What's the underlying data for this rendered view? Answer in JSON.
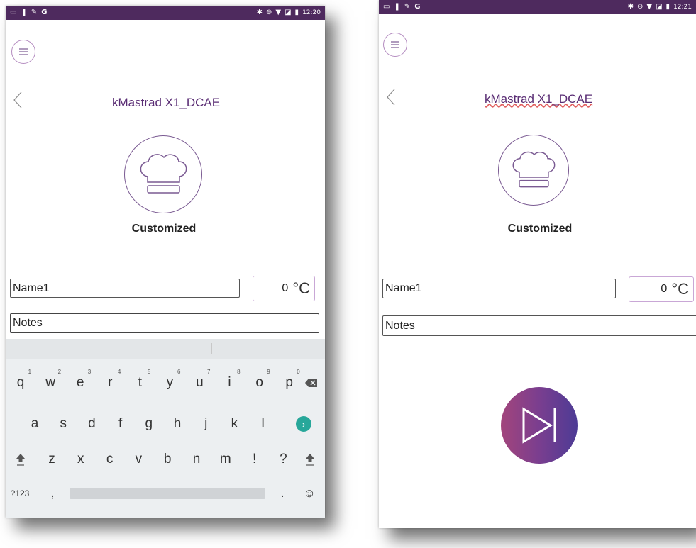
{
  "left_screen": {
    "status": {
      "time": "12:20"
    },
    "device_title": "kMastrad X1_DCAE",
    "mode_label": "Customized",
    "name_value": "Name1",
    "notes_value": "Notes",
    "temperature": {
      "value": "0",
      "unit": "°C"
    },
    "keyboard": {
      "row1": [
        {
          "k": "q",
          "h": "1"
        },
        {
          "k": "w",
          "h": "2"
        },
        {
          "k": "e",
          "h": "3"
        },
        {
          "k": "r",
          "h": "4"
        },
        {
          "k": "t",
          "h": "5"
        },
        {
          "k": "y",
          "h": "6"
        },
        {
          "k": "u",
          "h": "7"
        },
        {
          "k": "i",
          "h": "8"
        },
        {
          "k": "o",
          "h": "9"
        },
        {
          "k": "p",
          "h": "0"
        }
      ],
      "row2": [
        "a",
        "s",
        "d",
        "f",
        "g",
        "h",
        "j",
        "k",
        "l"
      ],
      "row3": [
        "z",
        "x",
        "c",
        "v",
        "b",
        "n",
        "m",
        "!",
        "?"
      ],
      "symbols_label": "?123",
      "comma": ",",
      "period": "."
    }
  },
  "right_screen": {
    "status": {
      "time": "12:21"
    },
    "device_title": "kMastrad X1_DCAE",
    "mode_label": "Customized",
    "name_value": "Name1",
    "notes_value": "Notes",
    "temperature": {
      "value": "0",
      "unit": "°C"
    }
  },
  "icons": {
    "menu": "hamburger-menu-icon",
    "back": "chevron-left-icon",
    "chef": "chef-hat-icon",
    "play": "skip-next-icon"
  },
  "colors": {
    "statusbar": "#4e2a5e",
    "accent": "#5a2d74",
    "keyboard_bg": "#eceff1",
    "go_key": "#27a79a"
  }
}
